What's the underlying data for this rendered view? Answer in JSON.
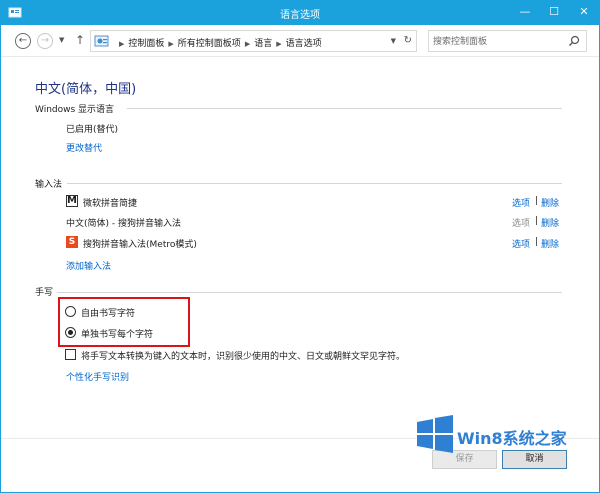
{
  "window": {
    "title": "语言选项",
    "accent_color": "#1ba2dc",
    "controls": {
      "minimize": "—",
      "maximize": "☐",
      "close": "✕"
    }
  },
  "nav": {
    "back_glyph": "←",
    "forward_glyph": "→",
    "dropdown_glyph": "▼",
    "up_glyph": "↑"
  },
  "address": {
    "icon": "control-panel-icon",
    "crumbs": [
      "控制面板",
      "所有控制面板项",
      "语言",
      "语言选项"
    ],
    "separator": "▶",
    "dropdown_glyph": "▼",
    "refresh_glyph": "↻"
  },
  "search": {
    "placeholder": "搜索控制面板",
    "icon": "search-icon"
  },
  "page": {
    "heading": "中文(简体，中国)",
    "display_language": {
      "title": "Windows 显示语言",
      "status": "已启用(替代)",
      "change_link": "更改替代"
    },
    "input_method": {
      "title": "输入法",
      "items": [
        {
          "icon": "ms-pinyin-icon",
          "icon_glyph": "M",
          "name": "微软拼音简捷",
          "options": "选项",
          "options_enabled": true,
          "delete": "删除"
        },
        {
          "icon": "",
          "icon_glyph": "",
          "name": "中文(简体) - 搜狗拼音输入法",
          "options": "选项",
          "options_enabled": false,
          "delete": "删除"
        },
        {
          "icon": "sogou-icon",
          "icon_glyph": "S",
          "name": "搜狗拼音输入法(Metro模式)",
          "options": "选项",
          "options_enabled": true,
          "delete": "删除"
        }
      ],
      "separator": "|",
      "add_link": "添加输入法"
    },
    "handwriting": {
      "title": "手写",
      "options": [
        {
          "label": "自由书写字符",
          "selected": false
        },
        {
          "label": "单独书写每个字符",
          "selected": true
        }
      ],
      "checkbox_label": "将手写文本转换为键入的文本时，识别很少使用的中文、日文或朝鲜文罕见字符。",
      "checkbox_checked": false,
      "personalize_link": "个性化手写识别"
    }
  },
  "buttons": {
    "save": "保存",
    "cancel": "取消"
  },
  "watermark": {
    "text": "Win8系统之家",
    "logo": "windows-logo-icon",
    "color": "#2f7fd3"
  }
}
